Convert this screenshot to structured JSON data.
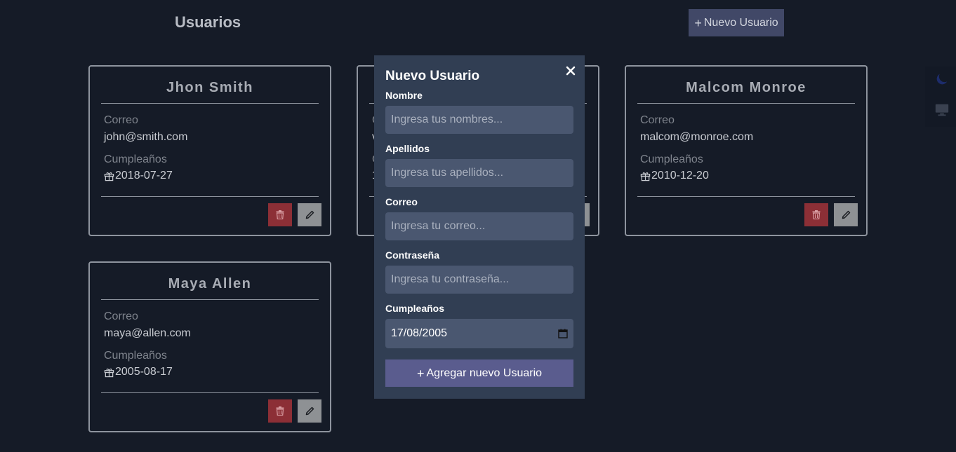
{
  "header": {
    "title": "Usuarios",
    "new_user_icon": "+",
    "new_user_label": "Nuevo Usuario"
  },
  "theme_switcher": {
    "items": [
      {
        "icon": "moon-icon",
        "color": "#1d2c6b"
      },
      {
        "icon": "monitor-icon",
        "color": "#3a4150"
      }
    ]
  },
  "users": [
    {
      "name": "Jhon Smith",
      "email_label": "Correo",
      "email": "john@smith.com",
      "birthday_label": "Cumpleaños",
      "birthday": "2018-07-27"
    },
    {
      "name": "",
      "email_label": "",
      "email": "",
      "birthday_label": "",
      "birthday": ""
    },
    {
      "name": "Malcom Monroe",
      "email_label": "Correo",
      "email": "malcom@monroe.com",
      "birthday_label": "Cumpleaños",
      "birthday": "2010-12-20"
    },
    {
      "name": "Maya Allen",
      "email_label": "Correo",
      "email": "maya@allen.com",
      "birthday_label": "Cumpleaños",
      "birthday": "2005-08-17"
    }
  ],
  "partial_card": {
    "fragment_1": "C",
    "fragment_2": "v",
    "fragment_3": "C",
    "fragment_4": "1"
  },
  "modal": {
    "title": "Nuevo Usuario",
    "close_icon": "×",
    "fields": {
      "nombre": {
        "label": "Nombre",
        "placeholder": "Ingresa tus nombres..."
      },
      "apellidos": {
        "label": "Apellidos",
        "placeholder": "Ingresa tus apellidos..."
      },
      "correo": {
        "label": "Correo",
        "placeholder": "Ingresa tu correo..."
      },
      "contrasena": {
        "label": "Contraseña",
        "placeholder": "Ingresa tu contraseña..."
      },
      "cumpleanos": {
        "label": "Cumpleaños",
        "value": "17/08/2005"
      }
    },
    "submit_icon": "+",
    "submit_label": "Agregar nuevo Usuario"
  },
  "colors": {
    "background": "#151b27",
    "modal_bg": "#313e53",
    "input_bg": "#4a5770",
    "accent": "#5a5c8e",
    "delete": "#8c2f36",
    "edit": "#8e9194"
  }
}
